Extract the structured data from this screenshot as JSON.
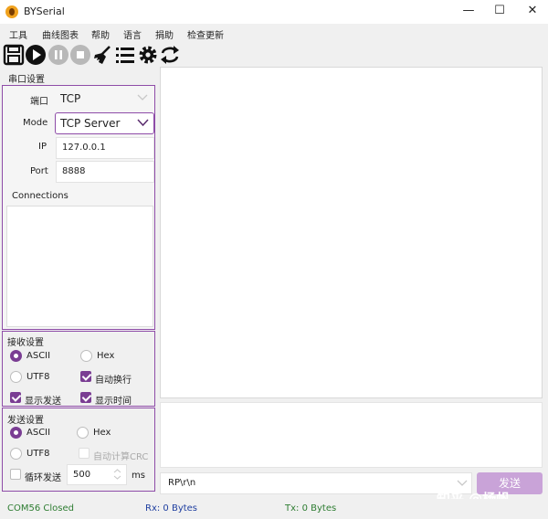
{
  "window": {
    "title": "BYSerial",
    "minimize": "—",
    "maximize": "☐",
    "close": "✕"
  },
  "menu": [
    "工具",
    "曲线图表",
    "帮助",
    "语言",
    "捐助",
    "检查更新"
  ],
  "toolbar_icons": [
    "save-icon",
    "play-icon",
    "pause-icon",
    "stop-icon",
    "clear-icon",
    "list-icon",
    "gear-icon",
    "swap-icon"
  ],
  "port_settings": {
    "section_title": "串口设置",
    "port_label": "端口",
    "port_value": "TCP",
    "mode_label": "Mode",
    "mode_value": "TCP Server",
    "ip_label": "IP",
    "ip_value": "127.0.0.1",
    "port_num_label": "Port",
    "port_num_value": "8888",
    "connections_label": "Connections"
  },
  "receive_settings": {
    "section_title": "接收设置",
    "ascii": "ASCII",
    "hex": "Hex",
    "utf8": "UTF8",
    "auto_newline": "自动换行",
    "show_send": "显示发送",
    "show_time": "显示时间"
  },
  "send_settings": {
    "section_title": "发送设置",
    "ascii": "ASCII",
    "hex": "Hex",
    "utf8": "UTF8",
    "auto_crc": "自动计算CRC",
    "loop_send": "循环发送",
    "interval": "500",
    "unit": "ms"
  },
  "send_line": {
    "value": "RP\\r\\n",
    "button": "发送"
  },
  "status": {
    "port": "COM56 Closed",
    "rx": "Rx: 0 Bytes",
    "tx": "Tx: 0 Bytes"
  },
  "watermark": "知乎 @杨帆",
  "colors": {
    "accent": "#7a3d93",
    "status_green": "#2e7d32",
    "status_blue": "#1f3fa0"
  }
}
